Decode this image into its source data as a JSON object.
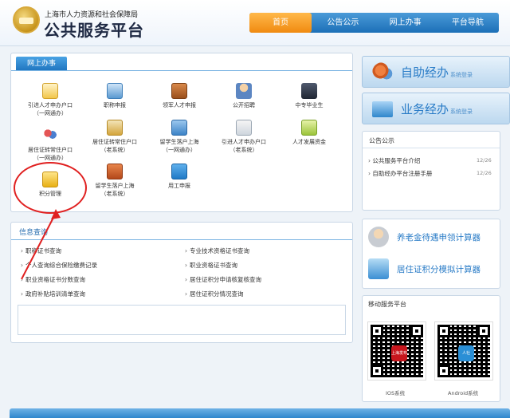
{
  "header": {
    "org_name": "上海市人力资源和社会保障局",
    "site_name": "公共服务平台",
    "nav": [
      "首页",
      "公告公示",
      "网上办事",
      "平台导航"
    ]
  },
  "online_services": {
    "title": "网上办事",
    "items": [
      {
        "label1": "引进人才申办户口",
        "label2": "（一网通办）",
        "icon": "document-icon"
      },
      {
        "label1": "职称申报",
        "label2": "",
        "icon": "pen-icon"
      },
      {
        "label1": "领军人才申报",
        "label2": "",
        "icon": "briefcase-icon"
      },
      {
        "label1": "公开招聘",
        "label2": "",
        "icon": "person-icon"
      },
      {
        "label1": "中专毕业生",
        "label2": "",
        "icon": "graduate-icon"
      },
      {
        "label1": "居住证转常住户口",
        "label2": "（一网通办）",
        "icon": "people-icon"
      },
      {
        "label1": "居住证转常住户口",
        "label2": "（老系统）",
        "icon": "house-icon"
      },
      {
        "label1": "留学生落户上海",
        "label2": "（一网通办）",
        "icon": "stack-icon"
      },
      {
        "label1": "引进人才申办户口",
        "label2": "（老系统）",
        "icon": "id-card-icon"
      },
      {
        "label1": "人才发展资金",
        "label2": "",
        "icon": "money-icon"
      },
      {
        "label1": "积分管理",
        "label2": "",
        "icon": "database-icon"
      },
      {
        "label1": "留学生落户上海",
        "label2": "（老系统）",
        "icon": "door-icon"
      },
      {
        "label1": "用工申报",
        "label2": "",
        "icon": "list-icon"
      }
    ]
  },
  "info_query": {
    "title": "信息查询",
    "left": [
      "职称证书查询",
      "个人查询综合保险缴费记录",
      "职业资格证书分数查询",
      "政府补贴培训清单查询"
    ],
    "right": [
      "专业技术资格证书查询",
      "职业资格证书查询",
      "居住证积分申请核复核查询",
      "居住证积分情况查询"
    ]
  },
  "side": {
    "self_service": {
      "title": "自助经办",
      "sub": "系统登录"
    },
    "business": {
      "title": "业务经办",
      "sub": "系统登录"
    }
  },
  "notices": {
    "title": "公告公示",
    "items": [
      {
        "text": "公共服务平台介绍",
        "date": "12/26"
      },
      {
        "text": "自助经办平台注册手册",
        "date": "12/26"
      }
    ]
  },
  "calculators": [
    "养老金待遇申领计算器",
    "居住证积分模拟计算器"
  ],
  "mobile": {
    "title": "移动服务平台",
    "ios_label": "IOS系统",
    "android_label": "Android系统",
    "ios_logo_text": "上海发布",
    "android_logo_text": "人社"
  },
  "colors": {
    "accent_blue": "#1e74bf",
    "active_orange": "#f08a10",
    "annotation_red": "#e02020"
  }
}
